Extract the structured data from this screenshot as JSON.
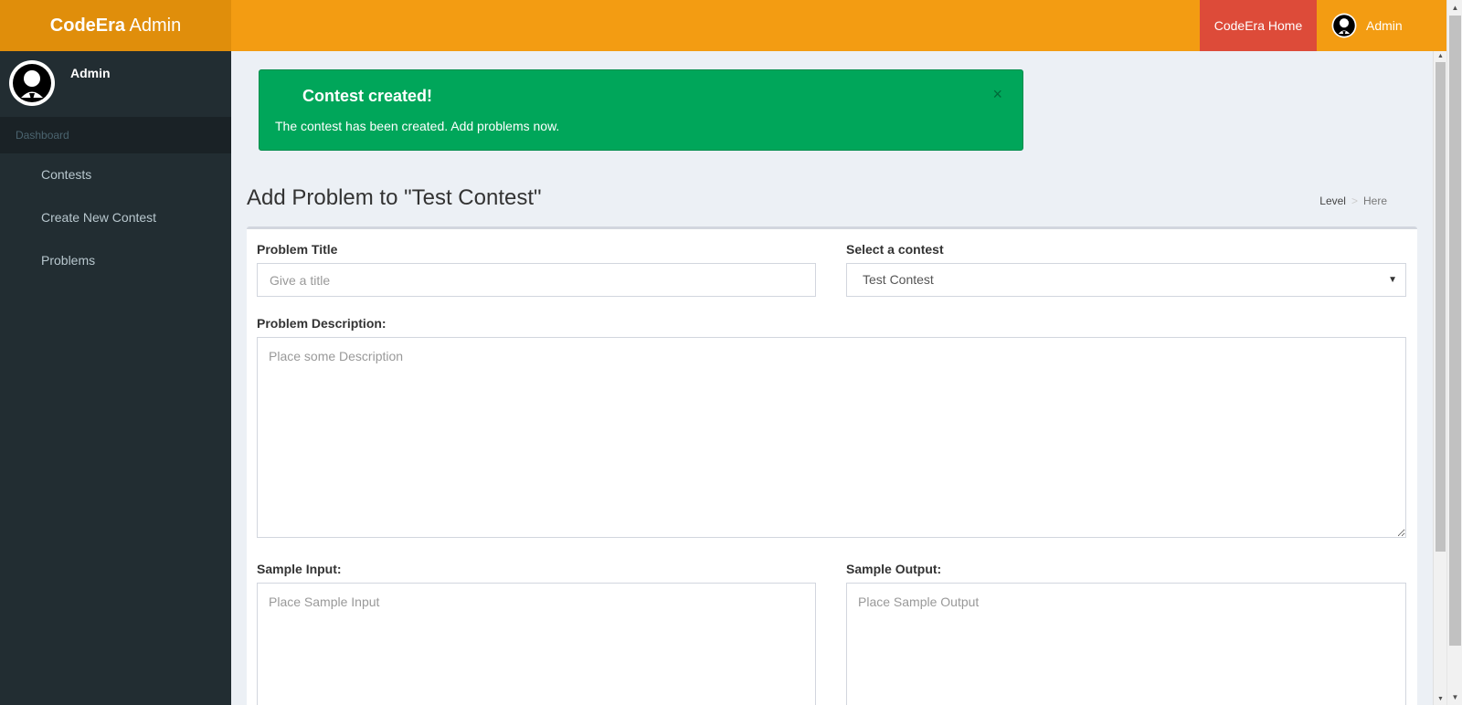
{
  "header": {
    "logo_bold": "CodeEra",
    "logo_rest": " Admin",
    "home_link": "CodeEra Home",
    "user_label": "Admin"
  },
  "sidebar": {
    "user_name": "Admin",
    "section_header": "Dashboard",
    "items": [
      {
        "label": "Contests"
      },
      {
        "label": "Create New Contest"
      },
      {
        "label": "Problems"
      }
    ]
  },
  "alert": {
    "title": "Contest created!",
    "text": "The contest has been created. Add problems now.",
    "close": "×"
  },
  "page": {
    "title": "Add Problem to \"Test Contest\"",
    "breadcrumb": [
      "Level",
      "Here"
    ],
    "breadcrumb_sep": ">"
  },
  "form": {
    "title_label": "Problem Title",
    "title_placeholder": "Give a title",
    "contest_label": "Select a contest",
    "contest_selected": "Test Contest",
    "description_label": "Problem Description:",
    "description_placeholder": "Place some Description",
    "sample_input_label": "Sample Input:",
    "sample_input_placeholder": "Place Sample Input",
    "sample_output_label": "Sample Output:",
    "sample_output_placeholder": "Place Sample Output"
  },
  "colors": {
    "header": "#f39c12",
    "logo": "#e08e0b",
    "home_button": "#dd4b39",
    "sidebar": "#222d32",
    "alert_success": "#00a65a"
  },
  "icons": {
    "avatar": "user-avatar-icon",
    "caret": "caret-down-icon",
    "close": "close-icon"
  }
}
